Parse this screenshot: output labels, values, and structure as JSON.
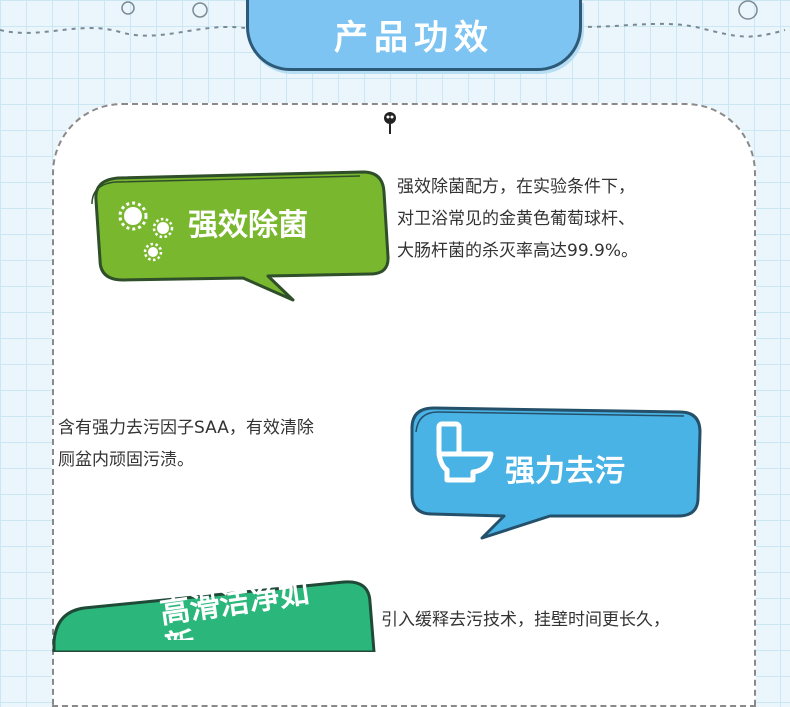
{
  "title": "产品功效",
  "features": [
    {
      "label": "强效除菌",
      "color": "#79b72e",
      "lines": [
        "强效除菌配方，在实验条件下，",
        "对卫浴常见的金黄色葡萄球杆、",
        "大肠杆菌的杀灭率高达99.9%。"
      ],
      "icon": "bacteria-icon"
    },
    {
      "label": "强力去污",
      "color": "#4ab3e6",
      "lines": [
        "含有强力去污因子SAA，有效清除",
        "厕盆内顽固污渍。"
      ],
      "icon": "toilet-icon"
    },
    {
      "label": "高滑洁净如新",
      "color": "#2bb77c",
      "lines": [
        "引入缓释去污技术，挂壁时间更长久，"
      ],
      "icon": ""
    }
  ]
}
